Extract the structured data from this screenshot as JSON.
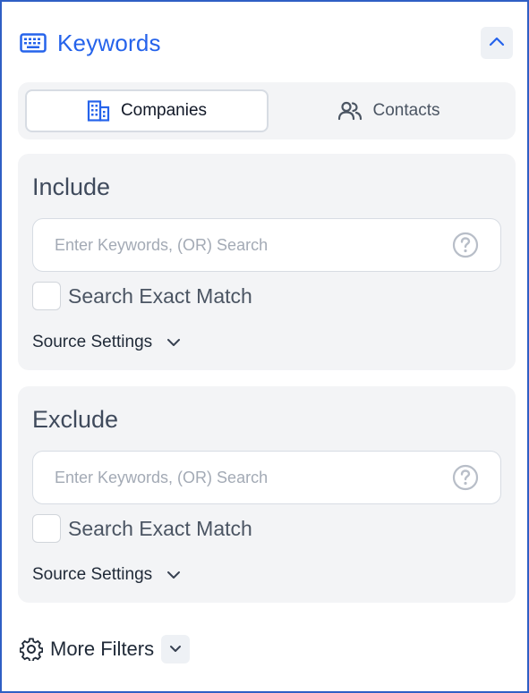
{
  "header": {
    "title": "Keywords",
    "icon": "keyboard-icon",
    "collapse_icon": "chevron-up-icon"
  },
  "tabs": [
    {
      "label": "Companies",
      "icon": "building-icon",
      "active": true
    },
    {
      "label": "Contacts",
      "icon": "users-icon",
      "active": false
    }
  ],
  "include": {
    "title": "Include",
    "input_placeholder": "Enter Keywords, (OR) Search",
    "input_value": "",
    "exact_match_label": "Search Exact Match",
    "exact_match_checked": false,
    "source_settings_label": "Source Settings"
  },
  "exclude": {
    "title": "Exclude",
    "input_placeholder": "Enter Keywords, (OR) Search",
    "input_value": "",
    "exact_match_label": "Search Exact Match",
    "exact_match_checked": false,
    "source_settings_label": "Source Settings"
  },
  "more_filters": {
    "label": "More Filters",
    "icon": "gear-icon"
  },
  "colors": {
    "accent": "#2563eb",
    "panel_border": "#2f5fc4",
    "section_bg": "#f3f4f6",
    "muted_text": "#4b5563"
  }
}
